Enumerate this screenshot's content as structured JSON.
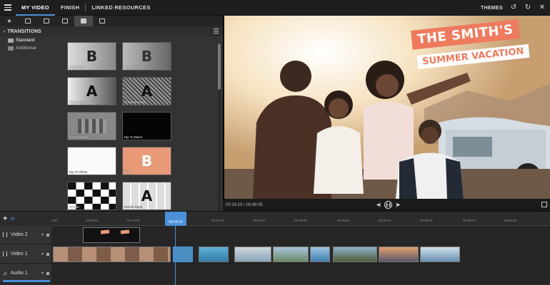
{
  "nav": {
    "tabs": [
      "MY VIDEO",
      "FINISH",
      "LINKED RESOURCES"
    ],
    "themes_label": "THEMES"
  },
  "icons": {
    "menu": "hamburger-icon",
    "undo": "undo-icon",
    "redo": "redo-icon",
    "close": "close-icon",
    "library": [
      "star-icon",
      "folder-icon",
      "media-icon",
      "layers-icon",
      "transitions-icon",
      "titles-icon"
    ]
  },
  "panel": {
    "title": "TRANSITIONS",
    "folders": [
      "Standard",
      "Additional"
    ],
    "transitions": [
      {
        "label": "Cross fade",
        "glyph": "B"
      },
      {
        "label": "Cross blur",
        "glyph": "B"
      },
      {
        "label": "Cross Zoom",
        "glyph": "A"
      },
      {
        "label": "Cross dissolve",
        "glyph": "A"
      },
      {
        "label": "Cross mosaic",
        "glyph": ""
      },
      {
        "label": "Dip To Black",
        "glyph": ""
      },
      {
        "label": "Dip To White",
        "glyph": ""
      },
      {
        "label": "Burn",
        "glyph": "B"
      },
      {
        "label": "Mosaic",
        "glyph": ""
      },
      {
        "label": "Puzzle Right",
        "glyph": "A"
      }
    ]
  },
  "preview": {
    "title_line1": "THE SMITH'S",
    "title_line2": "SUMMER VACATION",
    "timecode": "00:14:19 / 00:49:05"
  },
  "timeline": {
    "playhead": "00:14:19",
    "ticks": [
      "0:00",
      "00:05:00",
      "00:10:00",
      "00:15:00",
      "00:20:00",
      "00:25:00",
      "00:30:00",
      "00:35:00",
      "00:40:00",
      "00:45:00",
      "00:50:00",
      "00:55:00"
    ],
    "tracks": [
      {
        "name": "Video 2",
        "type": "video"
      },
      {
        "name": "Video 1",
        "type": "video"
      },
      {
        "name": "Audio 1",
        "type": "audio"
      }
    ]
  }
}
